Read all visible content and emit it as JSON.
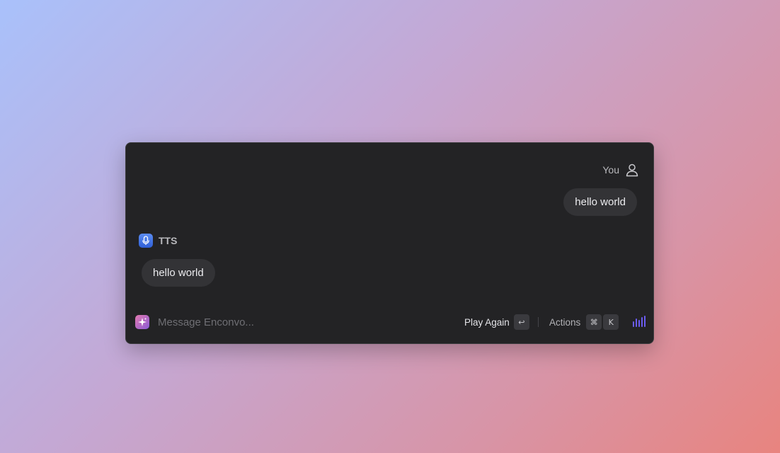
{
  "chat": {
    "user": {
      "name": "You",
      "icon": "person-icon",
      "message": "hello world"
    },
    "assistant": {
      "name": "TTS",
      "icon": "microphone-icon",
      "icon_color": "#3b6fe0",
      "message": "hello world"
    }
  },
  "composer": {
    "icon": "sparkle-icon",
    "placeholder": "Message Enconvo...",
    "value": ""
  },
  "toolbar": {
    "play_again_label": "Play Again",
    "play_again_key": "↩",
    "actions_label": "Actions",
    "actions_keys": [
      "⌘",
      "K"
    ],
    "audio_icon": "audio-bars-icon",
    "accent": "#6b5cf0"
  }
}
